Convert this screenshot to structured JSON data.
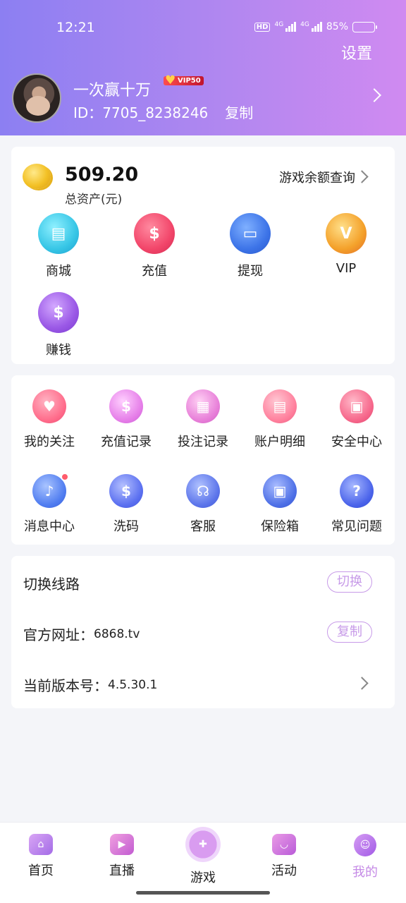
{
  "status_bar": {
    "time": "12:21",
    "hd": "HD",
    "net1": "4G",
    "net2": "4G",
    "battery": "85%"
  },
  "header": {
    "settings_label": "设置",
    "nickname": "一次赢十万",
    "vip_badge": "VIP50",
    "user_id": "ID：7705_8238246",
    "copy_label": "复制"
  },
  "balance": {
    "amount": "509.20",
    "label": "总资产(元)",
    "query_label": "游戏余额查询"
  },
  "quick_actions": [
    {
      "label": "商城",
      "icon": "shop-icon",
      "color": "#37c6e6"
    },
    {
      "label": "充值",
      "icon": "money-bag-icon",
      "color": "#f2466a"
    },
    {
      "label": "提现",
      "icon": "card-icon",
      "color": "#3d74e8"
    },
    {
      "label": "VIP",
      "icon": "vip-icon",
      "color": "#f4a12a"
    },
    {
      "label": "赚钱",
      "icon": "earn-bag-icon",
      "color": "#9a58e6"
    }
  ],
  "menu": [
    {
      "label": "我的关注",
      "icon": "heart-icon",
      "color": "#ff6b8a"
    },
    {
      "label": "充值记录",
      "icon": "recharge-record-icon",
      "color": "#e57de8"
    },
    {
      "label": "投注记录",
      "icon": "bet-record-icon",
      "color": "#e77ed8"
    },
    {
      "label": "账户明细",
      "icon": "account-detail-icon",
      "color": "#ff7f9c"
    },
    {
      "label": "安全中心",
      "icon": "security-icon",
      "color": "#f6668a"
    },
    {
      "label": "消息中心",
      "icon": "bell-icon",
      "color": "#4f7cf0"
    },
    {
      "label": "洗码",
      "icon": "chip-icon",
      "color": "#5a6ff0"
    },
    {
      "label": "客服",
      "icon": "headset-icon",
      "color": "#5b74ea"
    },
    {
      "label": "保险箱",
      "icon": "safe-icon",
      "color": "#4d6fe6"
    },
    {
      "label": "常见问题",
      "icon": "question-icon",
      "color": "#4a63ea"
    }
  ],
  "settings": {
    "switch_line_label": "切换线路",
    "switch_button": "切换",
    "site_label": "官方网址：",
    "site_value": "6868.tv",
    "copy_button": "复制",
    "version_label": "当前版本号：",
    "version_value": "4.5.30.1"
  },
  "tabs": [
    {
      "label": "首页",
      "icon": "home-icon",
      "color": "#b974ec"
    },
    {
      "label": "直播",
      "icon": "video-icon",
      "color": "#d768d4"
    },
    {
      "label": "游戏",
      "icon": "gamepad-icon",
      "color": "#c87ae8"
    },
    {
      "label": "活动",
      "icon": "gift-icon",
      "color": "#c869e0"
    },
    {
      "label": "我的",
      "icon": "smile-icon",
      "color": "#b46be8"
    }
  ]
}
